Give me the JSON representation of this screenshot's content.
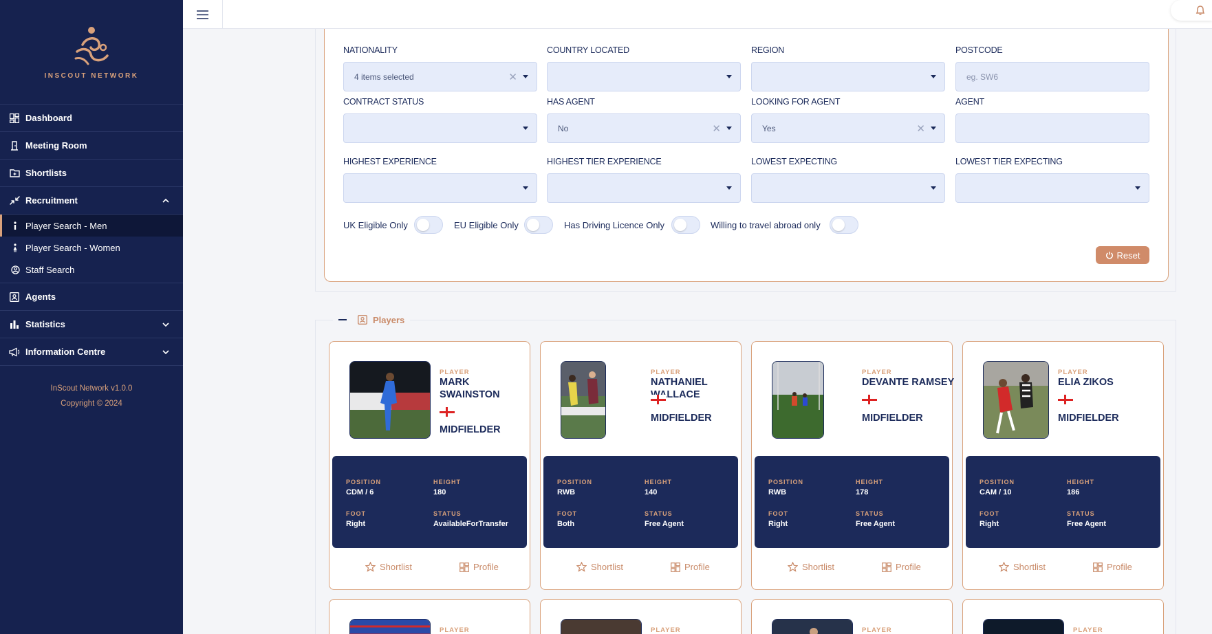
{
  "brand": {
    "name": "INSCOUT NETWORK",
    "accent": "#d9a17b",
    "navy": "#16224f"
  },
  "sidebar": {
    "items": [
      {
        "label": "Dashboard",
        "icon": "dashboard-grid-icon"
      },
      {
        "label": "Meeting Room",
        "icon": "door-icon"
      },
      {
        "label": "Shortlists",
        "icon": "folder-plus-icon"
      },
      {
        "label": "Recruitment",
        "icon": "arrows-compress-icon",
        "expanded": true
      },
      {
        "label": "Agents",
        "icon": "id-card-icon"
      },
      {
        "label": "Statistics",
        "icon": "bar-chart-icon"
      },
      {
        "label": "Information Centre",
        "icon": "megaphone-icon"
      }
    ],
    "recruitment_sub": [
      {
        "label": "Player Search - Men",
        "active": true
      },
      {
        "label": "Player Search - Women",
        "active": false
      },
      {
        "label": "Staff Search",
        "active": false
      }
    ],
    "version": "InScout Network v1.0.0",
    "copyright": "Copyright © 2024"
  },
  "filters": {
    "nationality": {
      "label": "NATIONALITY",
      "value": "4 items selected"
    },
    "country_located": {
      "label": "COUNTRY LOCATED",
      "value": ""
    },
    "region": {
      "label": "REGION",
      "value": ""
    },
    "postcode": {
      "label": "POSTCODE",
      "placeholder": "eg. SW6"
    },
    "contract_status": {
      "label": "CONTRACT STATUS",
      "value": ""
    },
    "has_agent": {
      "label": "HAS AGENT",
      "value": "No"
    },
    "looking_for_agent": {
      "label": "LOOKING FOR AGENT",
      "value": "Yes"
    },
    "agent": {
      "label": "AGENT",
      "value": ""
    },
    "highest_experience": {
      "label": "HIGHEST EXPERIENCE",
      "value": ""
    },
    "highest_tier_experience": {
      "label": "HIGHEST TIER EXPERIENCE",
      "value": ""
    },
    "lowest_expecting": {
      "label": "LOWEST EXPECTING",
      "value": ""
    },
    "lowest_tier_expecting": {
      "label": "LOWEST TIER EXPECTING",
      "value": ""
    },
    "toggles": [
      {
        "label": "UK Eligible Only",
        "on": false
      },
      {
        "label": "EU Eligible Only",
        "on": false
      },
      {
        "label": "Has Driving Licence Only",
        "on": false
      },
      {
        "label": "Willing to travel abroad only",
        "on": false
      }
    ],
    "reset_label": "Reset"
  },
  "players_section": {
    "title": "Players"
  },
  "card_labels": {
    "type": "PLAYER",
    "position": "POSITION",
    "height": "HEIGHT",
    "foot": "FOOT",
    "status": "STATUS",
    "shortlist": "Shortlist",
    "profile": "Profile"
  },
  "players": [
    {
      "name": "MARK SWAINSTON",
      "role": "MIDFIELDER",
      "position": "CDM / 6",
      "height": "180",
      "foot": "Right",
      "status": "AvailableForTransfer",
      "flag": "england"
    },
    {
      "name": "NATHANIEL WALLACE",
      "role": "MIDFIELDER",
      "position": "RWB",
      "height": "140",
      "foot": "Both",
      "status": "Free Agent",
      "flag": "england"
    },
    {
      "name": "DEVANTE RAMSEY",
      "role": "MIDFIELDER",
      "position": "RWB",
      "height": "178",
      "foot": "Right",
      "status": "Free Agent",
      "flag": "england"
    },
    {
      "name": "ELIA ZIKOS",
      "role": "MIDFIELDER",
      "position": "CAM / 10",
      "height": "186",
      "foot": "Right",
      "status": "Free Agent",
      "flag": "england"
    }
  ]
}
